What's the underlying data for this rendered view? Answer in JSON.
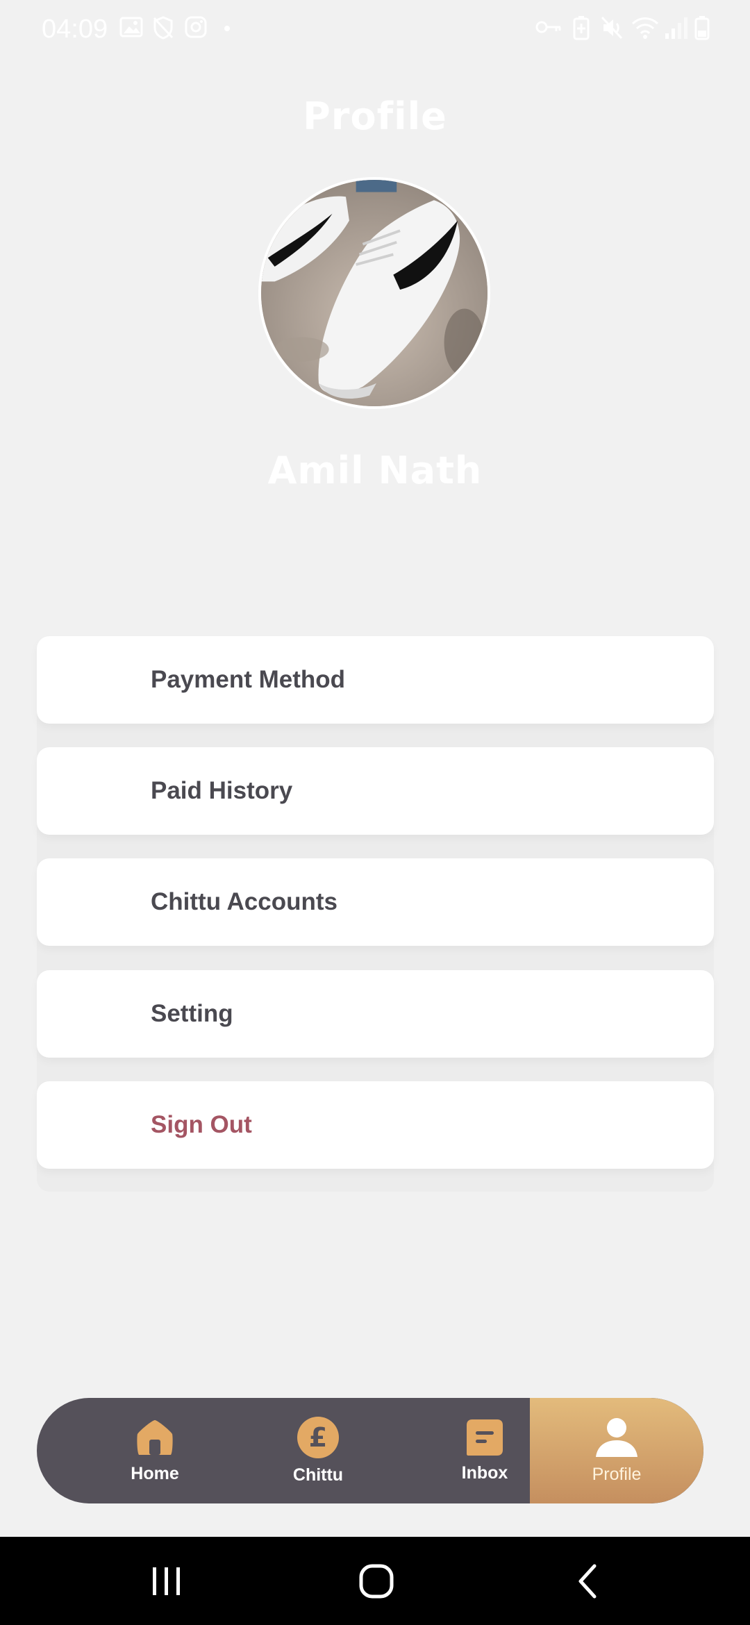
{
  "status_bar": {
    "time": "04:09",
    "left_icons": [
      "image-icon",
      "shield-off-icon",
      "instagram-icon",
      "dot-icon"
    ],
    "right_icons": [
      "key-icon",
      "battery-saver-icon",
      "mute-icon",
      "wifi-icon",
      "signal-icon",
      "battery-icon"
    ]
  },
  "header": {
    "title": "Profile",
    "avatar_icon": "sneaker-photo",
    "user_name": "Amil Nath"
  },
  "menu": {
    "items": [
      {
        "label": "Payment Method"
      },
      {
        "label": "Paid History"
      },
      {
        "label": "Chittu Accounts"
      },
      {
        "label": "Setting"
      },
      {
        "label": "Sign Out"
      }
    ]
  },
  "bottom_nav": {
    "items": [
      {
        "label": "Home",
        "icon": "home-icon"
      },
      {
        "label": "Chittu",
        "icon": "pound-icon"
      },
      {
        "label": "Inbox",
        "icon": "message-icon"
      },
      {
        "label": "Profile",
        "icon": "person-icon"
      }
    ],
    "active": "Profile"
  },
  "colors": {
    "background": "#f1f1f1",
    "nav_dark": "#55515a",
    "accent_gold": "#e3bb7c",
    "accent_copper": "#c58f5f",
    "danger": "#a45563",
    "menu_text": "#4a4950"
  }
}
